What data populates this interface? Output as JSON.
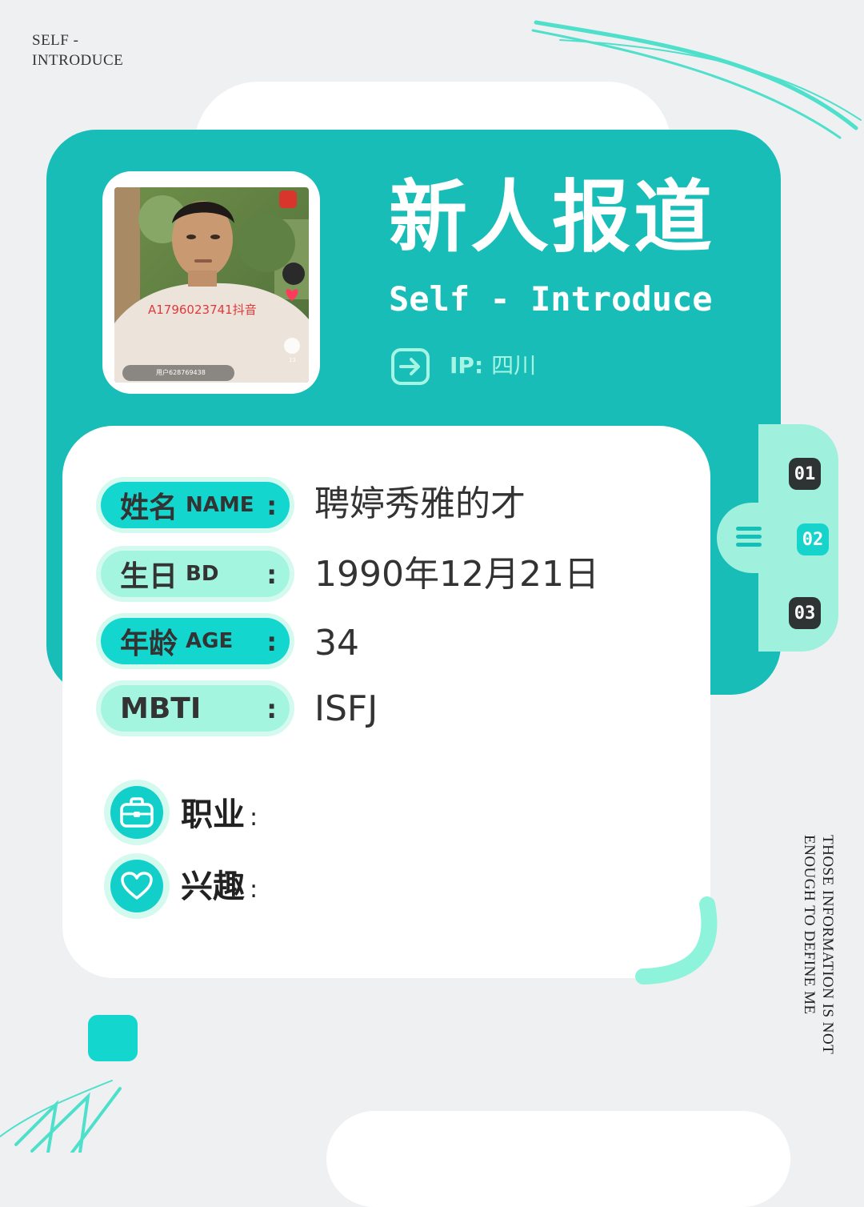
{
  "corner_label": "SELF - INTRODUCE",
  "header": {
    "title_cn": "新人报道",
    "title_en": "Self - Introduce",
    "ip_label": "IP:",
    "ip_value": "四川"
  },
  "photo_overlay": {
    "watermark": "A1796023741抖音",
    "user_text": "用户628769438",
    "comment_count": "13"
  },
  "side_nav": [
    "01",
    "02",
    "03"
  ],
  "fields": [
    {
      "cn": "姓名",
      "en": "NAME",
      "colon": ":",
      "value": "聘婷秀雅的才"
    },
    {
      "cn": "生日",
      "en": "BD",
      "colon": ":",
      "value": "1990年12月21日"
    },
    {
      "cn": "年龄",
      "en": "AGE",
      "colon": ":",
      "value": "34"
    },
    {
      "cn": "MBTI",
      "en": "",
      "colon": ":",
      "value": "ISFJ"
    }
  ],
  "extras": [
    {
      "label": "职业",
      "colon": ":",
      "icon": "briefcase-icon"
    },
    {
      "label": "兴趣",
      "colon": ":",
      "icon": "heart-icon"
    }
  ],
  "vertical_note": "THOSE INFORMATION IS NOT ENOUGH TO DEFINE ME",
  "colors": {
    "teal": "#19bdb8",
    "bright_teal": "#13d6ce",
    "mint": "#a3f5e0",
    "dark": "#2e3433",
    "background": "#eff0f2"
  }
}
